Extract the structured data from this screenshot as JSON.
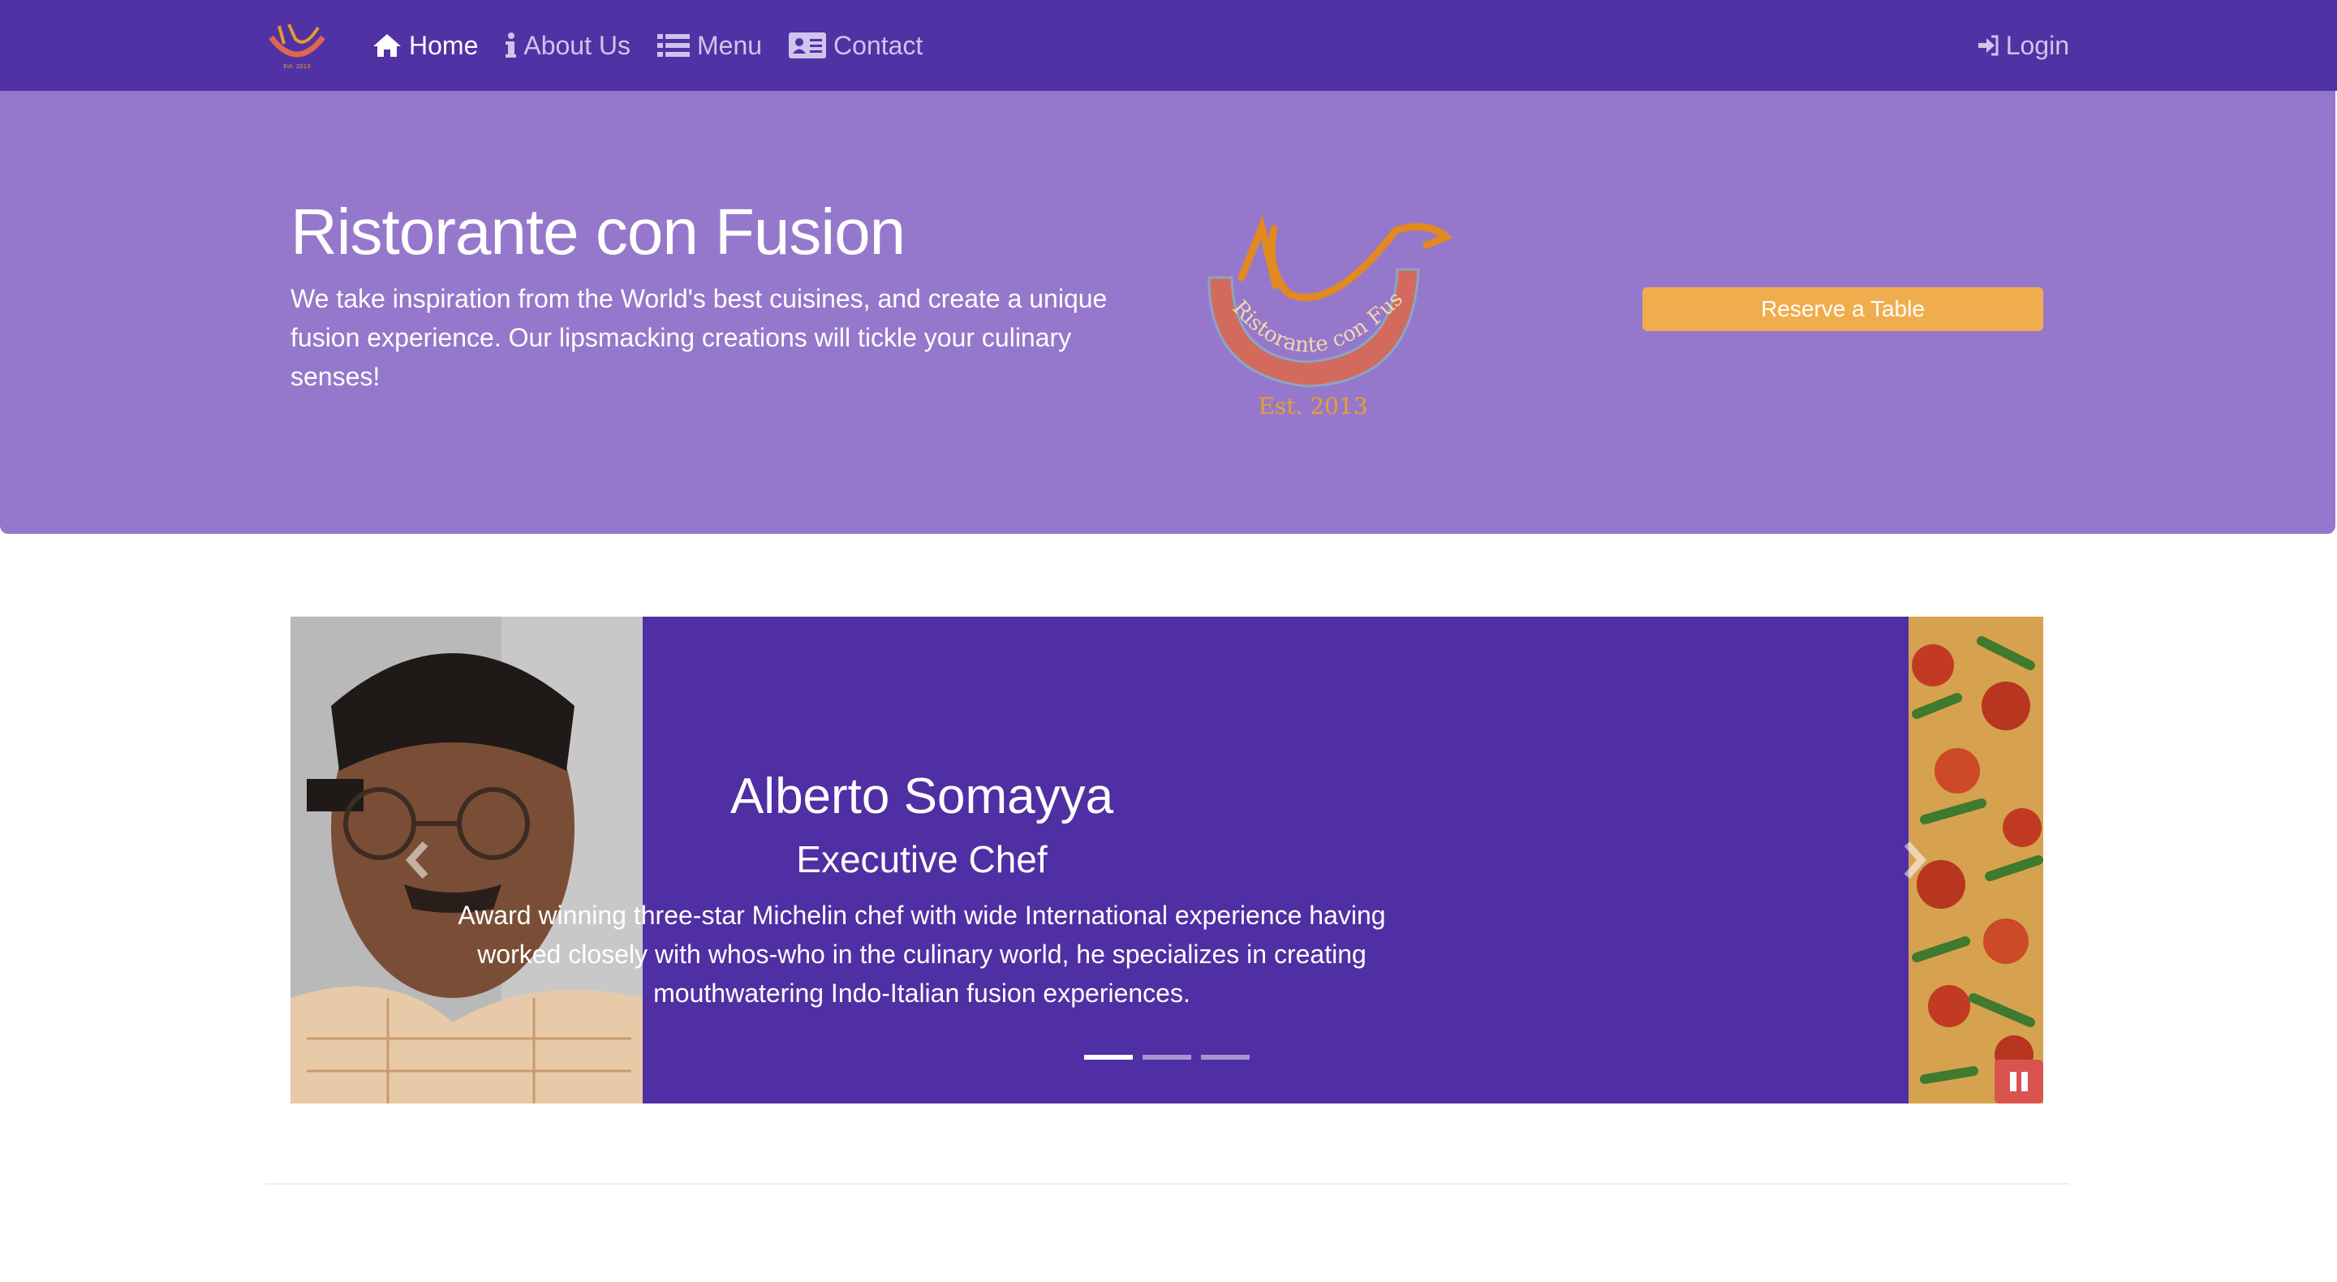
{
  "colors": {
    "navbar": "#5032a5",
    "jumbotron": "#9578cb",
    "carousel_bg": "#4f2fa3",
    "reserve_button": "#f0ad4e",
    "pause_button": "#d9534f"
  },
  "navbar": {
    "logo_icon": "restaurant-logo",
    "items": [
      {
        "label": "Home",
        "icon": "home-icon",
        "active": true
      },
      {
        "label": "About Us",
        "icon": "info-icon",
        "active": false
      },
      {
        "label": "Menu",
        "icon": "list-icon",
        "active": false
      },
      {
        "label": "Contact",
        "icon": "address-card-icon",
        "active": false
      }
    ],
    "login": {
      "label": "Login",
      "icon": "sign-in-icon"
    }
  },
  "jumbotron": {
    "title": "Ristorante con Fusion",
    "description": "We take inspiration from the World's best cuisines, and create a unique fusion experience. Our lipsmacking creations will tickle your culinary senses!",
    "logo_text": "Ristorante con Fusion",
    "logo_est": "Est. 2013",
    "reserve_label": "Reserve a Table"
  },
  "carousel": {
    "slide": {
      "name": "Alberto Somayya",
      "role": "Executive Chef",
      "description": "Award winning three-star Michelin chef with wide International experience having worked closely with whos-who in the culinary world, he specializes in creating mouthwatering Indo-Italian fusion experiences."
    },
    "indicator_count": 3,
    "active_indicator": 1,
    "prev_icon": "chevron-left-icon",
    "next_icon": "chevron-right-icon",
    "pause_icon": "pause-icon"
  }
}
